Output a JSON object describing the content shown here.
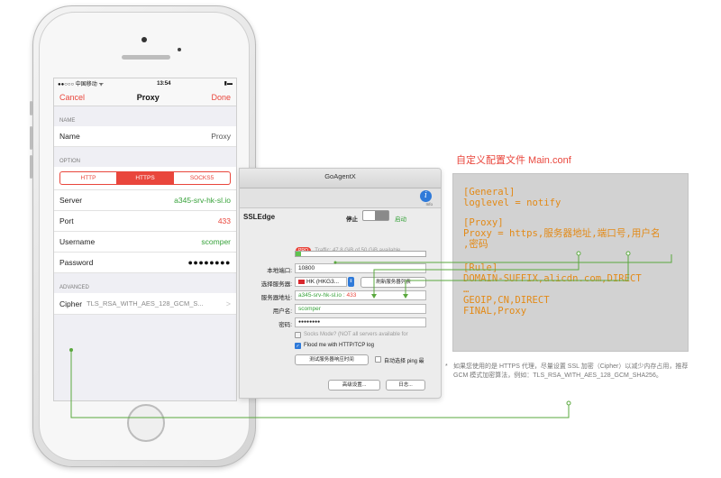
{
  "phone": {
    "status": {
      "carrier": "●●○○○ 中国移动 ᯤ",
      "time": "13:54",
      "battery": "▮▬"
    },
    "nav": {
      "cancel": "Cancel",
      "title": "Proxy",
      "done": "Done"
    },
    "sections": {
      "name": "NAME",
      "option": "OPTION",
      "advanced": "ADVANCED"
    },
    "name_row": {
      "label": "Name",
      "value": "Proxy"
    },
    "segments": [
      "HTTP",
      "HTTPS",
      "SOCKS5"
    ],
    "rows": [
      {
        "label": "Server",
        "value": "a345-srv-hk-sl.io"
      },
      {
        "label": "Port",
        "value": "433"
      },
      {
        "label": "Username",
        "value": "scomper"
      },
      {
        "label": "Password",
        "value": "●●●●●●●●"
      }
    ],
    "cipher": {
      "label": "Cipher",
      "value": "TLS_RSA_WITH_AES_128_GCM_S...",
      "chevron": ">"
    }
  },
  "app": {
    "window_title": "GoAgentX",
    "info_label": "Info",
    "section_title": "SSLEdge",
    "stop_label": "停止",
    "start_label": "启动",
    "pro_badge": "PRO",
    "traffic": "Traffic: 47.8 GiB of 50 GiB available",
    "traffic_fraction": 0.04,
    "local_port_label": "本地端口:",
    "local_port": "10800",
    "server_select_label": "选择服务器:",
    "server_selected": "HK (HKG3...",
    "refresh_list": "刷新服务器列表",
    "server_addr_label": "服务器地址:",
    "server_addr": "a345-srv-hk-sl.io : ",
    "server_port": "433",
    "username_label": "用户名:",
    "username": "scomper",
    "password_label": "密码:",
    "password": "●●●●●●●●",
    "socks_mode": "Socks Mode? (NOT all servers available for",
    "flood": "Flood me with HTTP/TCP log",
    "test_button": "测试服务器响应时间",
    "auto_select": "自动选择 ping 最",
    "advanced_button": "高级设置...",
    "log_button": "日志..."
  },
  "config": {
    "title": "自定义配置文件   Main.conf",
    "lines": [
      "[General]",
      "loglevel = notify",
      "",
      "[Proxy]",
      "Proxy = https,服务器地址,端口号,用户名",
      ",密码",
      "",
      "[Rule]",
      "DOMAIN-SUFFIX,alicdn.com,DIRECT",
      "…",
      "GEOIP,CN,DIRECT",
      "FINAL,Proxy"
    ],
    "note_mark": "*",
    "note": "如果您使用的是 HTTPS 代理，尽量设置 SSL 加密（Cipher）以减少内存占用，推荐 GCM 模式加密算法，例如：TLS_RSA_WITH_AES_128_GCM_SHA256。"
  },
  "colors": {
    "accent_red": "#e9463c",
    "config_text": "#e38a17",
    "connector": "#5aa83e",
    "toggle_green": "#37a23a"
  }
}
